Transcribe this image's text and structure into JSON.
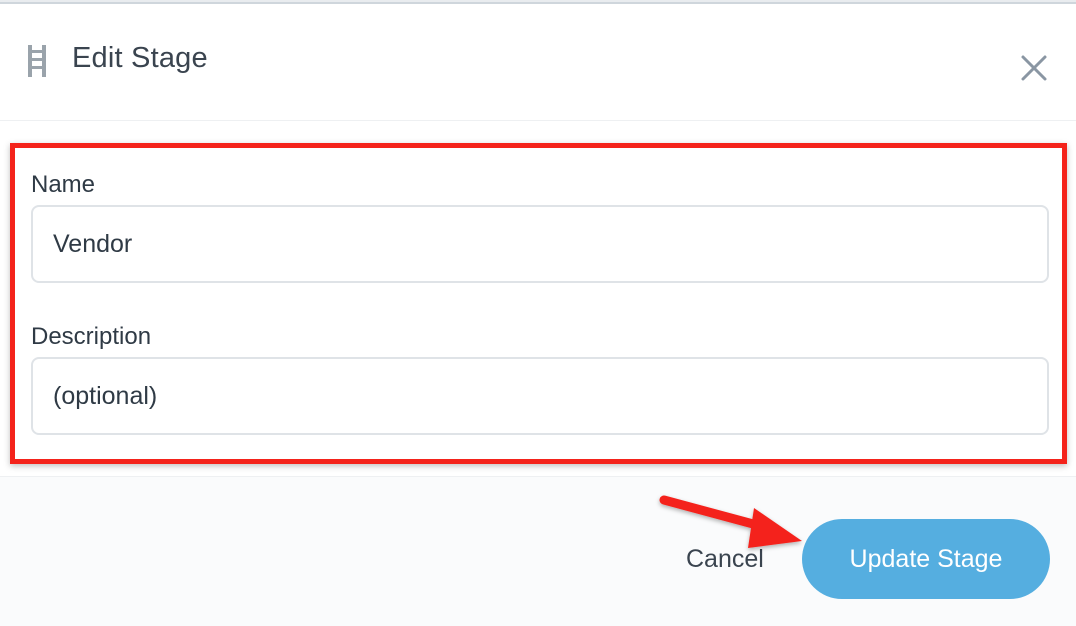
{
  "dialog": {
    "title": "Edit Stage",
    "icon": "ladder-icon",
    "close_icon": "close-icon"
  },
  "form": {
    "name_label": "Name",
    "name_value": "Vendor",
    "description_label": "Description",
    "description_value": "",
    "description_placeholder": "(optional)"
  },
  "footer": {
    "cancel_label": "Cancel",
    "update_label": "Update Stage"
  },
  "colors": {
    "primary_button": "#55aee0",
    "annotation_red": "#f4231b",
    "text": "#2f3a45"
  }
}
